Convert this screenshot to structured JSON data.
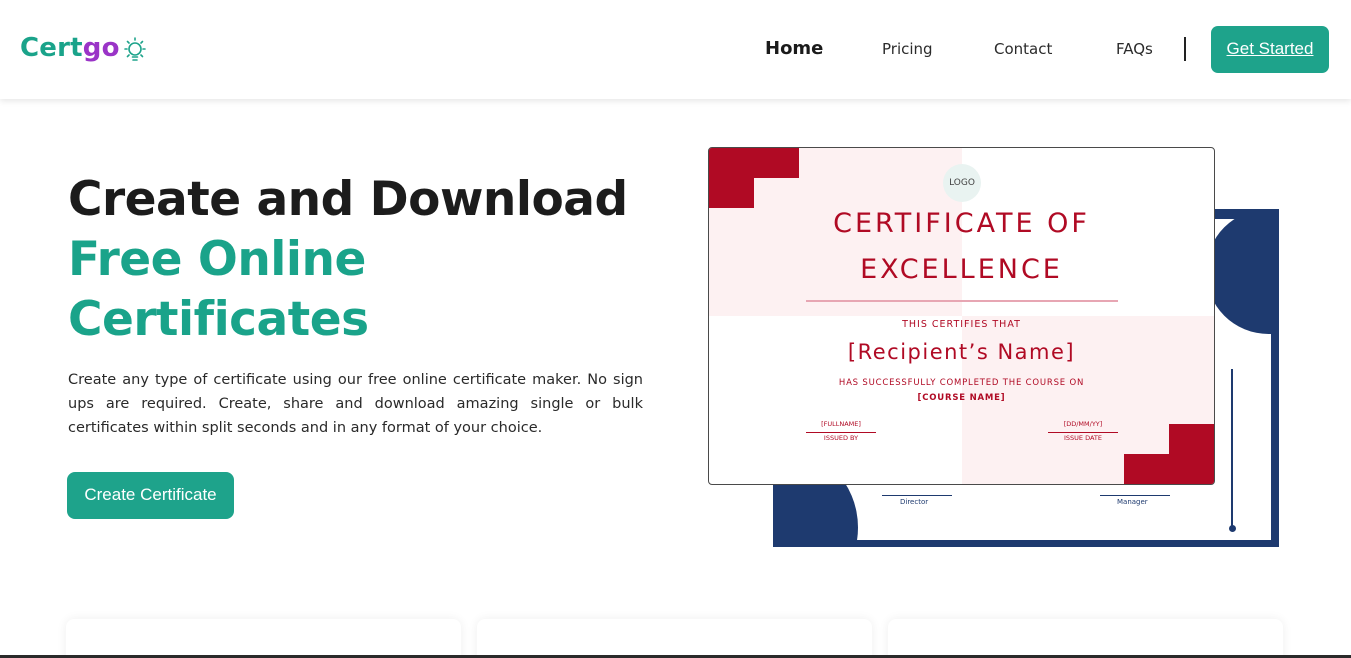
{
  "header": {
    "logo_part1": "Cert",
    "logo_part2": "go",
    "nav": [
      "Home",
      "Pricing",
      "Contact",
      "FAQs"
    ],
    "active_nav": "Home",
    "cta_label": "Get Started"
  },
  "hero": {
    "title_line1": "Create and Download",
    "title_line2": "Free Online",
    "title_line3": "Certificates",
    "description": "Create any type of certificate using our free online certificate maker. No sign ups are required. Create, share and download amazing single or bulk certificates within split seconds and in any format of your choice.",
    "button_label": "Create Certificate"
  },
  "certificate": {
    "logo_text": "LOGO",
    "title_line1": "CERTIFICATE OF",
    "title_line2": "EXCELLENCE",
    "certifies": "THIS CERTIFIES THAT",
    "recipient": "[Recipient’s Name]",
    "completed": "HAS SUCCESSFULLY COMPLETED THE COURSE ON",
    "course": "[COURSE NAME]",
    "fullname": "[FULLNAME]",
    "issued_by": "ISSUED BY",
    "date": "[DD/MM/YY]",
    "issue_date": "ISSUE DATE",
    "back_director": "Director",
    "back_manager": "Manager"
  },
  "colors": {
    "brand_green": "#1ea38b",
    "brand_purple": "#9a34c7",
    "cert_red": "#b00a24",
    "cert_navy": "#1e3a6f"
  }
}
